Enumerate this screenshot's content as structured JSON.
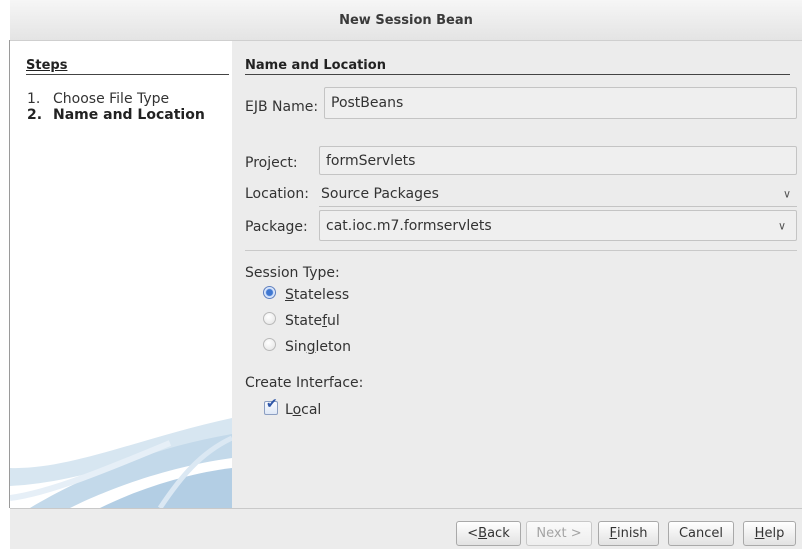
{
  "window": {
    "title": "New Session Bean"
  },
  "steps": {
    "title": "Steps",
    "items": [
      {
        "num": "1.",
        "label": "Choose File Type",
        "active": false
      },
      {
        "num": "2.",
        "label": "Name and Location",
        "active": true
      }
    ]
  },
  "form": {
    "section_title": "Name and Location",
    "ejb_name": {
      "label": "EJB Name:",
      "value": "PostBeans"
    },
    "project": {
      "label": "Project:",
      "value": "formServlets"
    },
    "location": {
      "label": "Location:",
      "value": "Source Packages"
    },
    "package": {
      "label": "Package:",
      "value": "cat.ioc.m7.formservlets"
    },
    "session_type": {
      "label": "Session Type:",
      "options": [
        {
          "pre": "",
          "mnemonic": "S",
          "post": "tateless",
          "selected": true
        },
        {
          "pre": "State",
          "mnemonic": "f",
          "post": "ul",
          "selected": false
        },
        {
          "pre": "Sin",
          "mnemonic": "g",
          "post": "leton",
          "selected": false
        }
      ]
    },
    "interface": {
      "label": "Create Interface:",
      "local": {
        "pre": "L",
        "mnemonic": "o",
        "post": "cal",
        "checked": true
      }
    }
  },
  "buttons": {
    "back": {
      "pre": "< ",
      "mnemonic": "B",
      "post": "ack",
      "enabled": true
    },
    "next": {
      "label": "Next >",
      "enabled": false
    },
    "finish": {
      "pre": "",
      "mnemonic": "F",
      "post": "inish",
      "enabled": true
    },
    "cancel": {
      "label": "Cancel",
      "enabled": true
    },
    "help": {
      "pre": "",
      "mnemonic": "H",
      "post": "elp",
      "enabled": true
    }
  },
  "colors": {
    "accent": "#3f77d1",
    "panel": "#ececec"
  }
}
